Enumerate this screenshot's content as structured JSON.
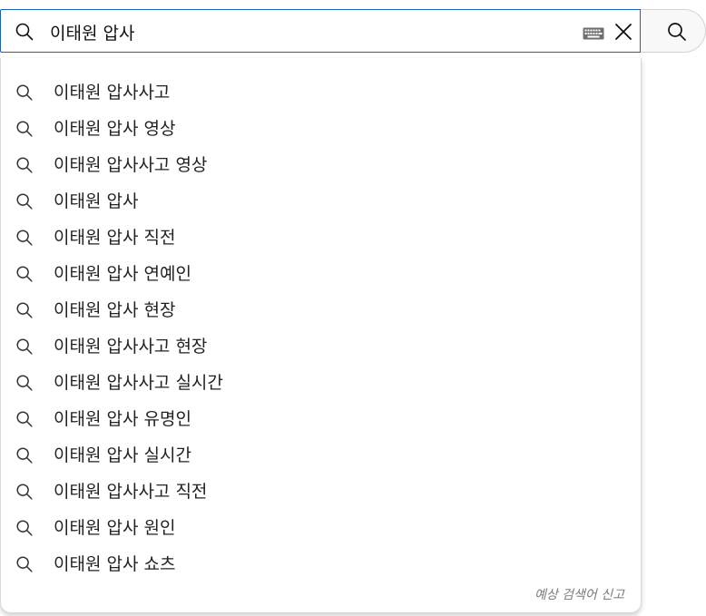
{
  "search": {
    "query": "이태원 압사",
    "keyboard_icon": "keyboard-icon",
    "clear_icon": "close-icon",
    "submit_icon": "search-icon"
  },
  "suggestions": [
    "이태원 압사사고",
    "이태원 압사 영상",
    "이태원 압사사고 영상",
    "이태원 압사",
    "이태원 압사 직전",
    "이태원 압사 연예인",
    "이태원 압사 현장",
    "이태원 압사사고 현장",
    "이태원 압사사고 실시간",
    "이태원 압사 유명인",
    "이태원 압사 실시간",
    "이태원 압사사고 직전",
    "이태원 압사 원인",
    "이태원 압사 쇼츠"
  ],
  "report_label": "예상 검색어 신고",
  "colors": {
    "focus_border": "#1c62b9",
    "button_bg": "#f8f8f8",
    "text": "#222222",
    "muted": "#7a7a7a"
  }
}
